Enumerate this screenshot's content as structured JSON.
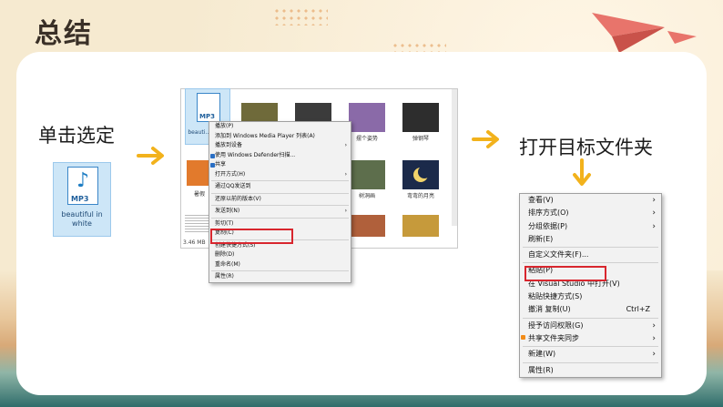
{
  "slide": {
    "title": "总结",
    "step1_label": "单击选定",
    "step2_label": "打开目标文件夹"
  },
  "file_icon": {
    "type_label": "MP3",
    "name": "beautiful  in white",
    "small_type_label": "MP3",
    "small_name": "beauti… whi…"
  },
  "explorer": {
    "thumb_labels": [
      "",
      "",
      "摆个姿势",
      "弹钢琴",
      "",
      "",
      "树洞画",
      "弯弯的月亮"
    ],
    "left_labels": [
      "暑假",
      ""
    ],
    "status_text": "3.46 MB"
  },
  "context_menu_file": {
    "items": [
      {
        "label": "播放(P)",
        "sep_after": false
      },
      {
        "label": "添加到 Windows Media Player 列表(A)",
        "sep_after": false
      },
      {
        "label": "播放到设备",
        "sep_after": false,
        "submenu": true
      },
      {
        "label": "使用 Windows Defender扫描...",
        "sep_after": false,
        "icon": "shield"
      },
      {
        "label": "共享",
        "sep_after": false,
        "icon": "share"
      },
      {
        "label": "打开方式(H)",
        "sep_after": true,
        "submenu": true
      },
      {
        "label": "通过QQ发送到",
        "sep_after": true
      },
      {
        "label": "还原以前的版本(V)",
        "sep_after": true
      },
      {
        "label": "发送到(N)",
        "sep_after": true,
        "submenu": true
      },
      {
        "label": "剪切(T)",
        "sep_after": false
      },
      {
        "label": "复制(C)",
        "sep_after": true,
        "highlight": true
      },
      {
        "label": "创建快捷方式(S)",
        "sep_after": false
      },
      {
        "label": "删除(D)",
        "sep_after": false
      },
      {
        "label": "重命名(M)",
        "sep_after": true
      },
      {
        "label": "属性(R)",
        "sep_after": false
      }
    ]
  },
  "context_menu_folder": {
    "items": [
      {
        "label": "查看(V)",
        "submenu": true,
        "sep_after": false
      },
      {
        "label": "排序方式(O)",
        "submenu": true,
        "sep_after": false
      },
      {
        "label": "分组依据(P)",
        "submenu": true,
        "sep_after": false
      },
      {
        "label": "刷新(E)",
        "sep_after": true
      },
      {
        "label": "自定义文件夹(F)...",
        "sep_after": true
      },
      {
        "label": "粘贴(P)",
        "sep_after": false,
        "highlight": true
      },
      {
        "label": "在 Visual Studio 中打开(V)",
        "sep_after": false
      },
      {
        "label": "粘贴快捷方式(S)",
        "sep_after": false
      },
      {
        "label": "撤消 复制(U)",
        "shortcut": "Ctrl+Z",
        "sep_after": true
      },
      {
        "label": "授予访问权限(G)",
        "submenu": true,
        "sep_after": false
      },
      {
        "label": "共享文件夹同步",
        "submenu": true,
        "sep_after": true,
        "icon": "sync"
      },
      {
        "label": "新建(W)",
        "submenu": true,
        "sep_after": true
      },
      {
        "label": "属性(R)",
        "sep_after": false
      }
    ]
  },
  "colors": {
    "accent_arrow": "#f2b21c",
    "highlight_box": "#d8262e",
    "plane": "#e8746b"
  }
}
